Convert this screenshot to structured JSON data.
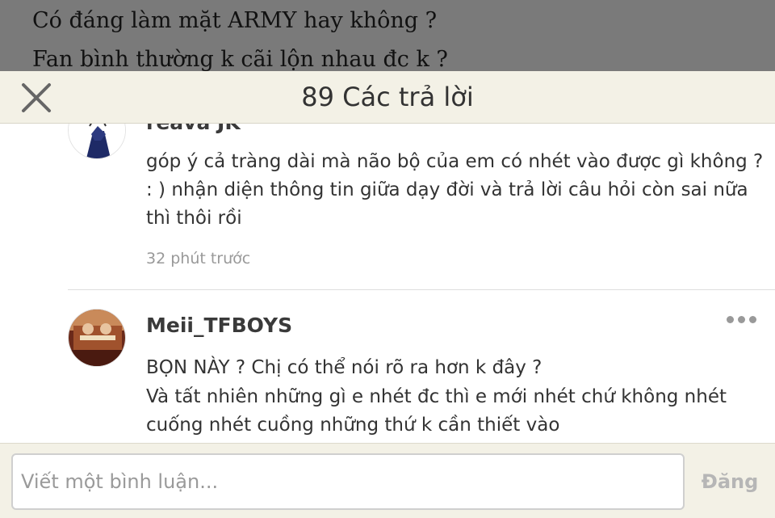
{
  "background_post": {
    "line1": "Có đáng làm mặt ARMY hay không ?",
    "line2": "Fan bình thường k cãi lộn nhau đc k ?"
  },
  "header": {
    "title": "89 Các trả lời",
    "close_icon": "close-icon"
  },
  "comments": [
    {
      "author": "reava JK",
      "lines": [
        "góp ý cả tràng dài mà não bộ của em có nhét vào được gì không ?",
        ": ) nhận diện thông tin giữa dạy đời và trả lời câu hỏi còn sai nữa",
        "thì thôi rồi"
      ],
      "time": "32 phút trước"
    },
    {
      "author": "Meii_TFBOYS",
      "lines": [
        "BỌN NÀY ? Chị có thể nói rõ ra hơn k đây ?",
        "Và tất nhiên những gì e nhét đc thì e mới nhét chứ không nhét",
        "cuống nhét cuồng những thứ k cần thiết vào"
      ],
      "more_icon": "more-dots-icon"
    }
  ],
  "composer": {
    "placeholder": "Viết một bình luận...",
    "post_label": "Đăng"
  },
  "colors": {
    "header_bg": "#f3f1e6",
    "dim_overlay": "#7a7a7a",
    "disabled_text": "#b6b6b6"
  }
}
